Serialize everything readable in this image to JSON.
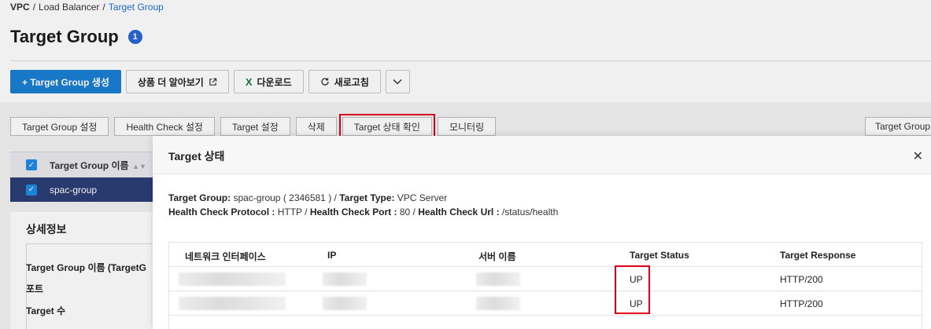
{
  "breadcrumb": {
    "root": "VPC",
    "sep": "/",
    "middle": "Load Balancer",
    "current": "Target Group"
  },
  "page": {
    "title": "Target Group",
    "badge": "1"
  },
  "toolbar": {
    "create_label": "+ Target Group 생성",
    "learn_label": "상품 더 알아보기",
    "download_label": "다운로드",
    "refresh_label": "새로고침"
  },
  "actions": {
    "settings": "Target Group 설정",
    "health_check": "Health Check 설정",
    "target_settings": "Target 설정",
    "delete": "삭제",
    "target_status": "Target 상태 확인",
    "monitoring": "모니터링",
    "right_button": "Target Group"
  },
  "list": {
    "header": "Target Group 이름",
    "row_name": "spac-group"
  },
  "detail": {
    "title": "상세정보",
    "items": [
      "Target Group 이름 (TargetG",
      "포트",
      "Target 수"
    ]
  },
  "modal": {
    "title": "Target 상태",
    "info": {
      "tg_label": "Target Group:",
      "tg_value": " spac-group ( 2346581 ) / ",
      "type_label": "Target Type:",
      "type_value": " VPC Server",
      "protocol_label": "Health Check Protocol :",
      "protocol_value": " HTTP / ",
      "port_label": "Health Check Port :",
      "port_value": " 80 / ",
      "url_label": "Health Check Url :",
      "url_value": " /status/health"
    },
    "columns": [
      "네트워크 인터페이스",
      "IP",
      "서버 이름",
      "Target Status",
      "Target Response"
    ],
    "rows": [
      {
        "status": "UP",
        "response": "HTTP/200"
      },
      {
        "status": "UP",
        "response": "HTTP/200"
      }
    ]
  },
  "colors": {
    "primary": "#1a7fd4",
    "selected_row": "#2c3e76",
    "highlight": "#e3001b",
    "link": "#1f6fd8"
  }
}
